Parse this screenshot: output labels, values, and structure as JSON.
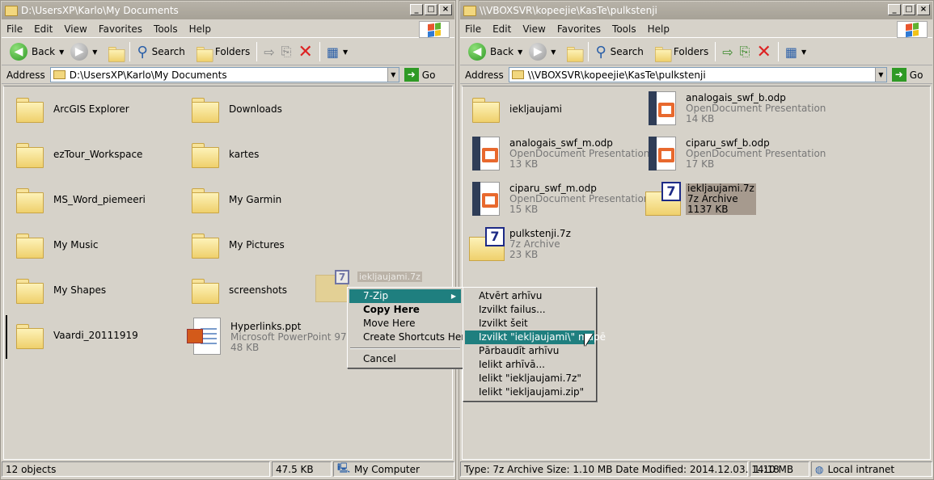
{
  "left": {
    "title": "D:\\UsersXP\\Karlo\\My Documents",
    "menu": [
      "File",
      "Edit",
      "View",
      "Favorites",
      "Tools",
      "Help"
    ],
    "toolbar": {
      "back": "Back",
      "search": "Search",
      "folders": "Folders"
    },
    "address_label": "Address",
    "address": "D:\\UsersXP\\Karlo\\My Documents",
    "go": "Go",
    "items": [
      {
        "name": "ArcGIS Explorer",
        "type": "folder"
      },
      {
        "name": "Downloads",
        "type": "folder"
      },
      {
        "name": "ezTour_Workspace",
        "type": "folder"
      },
      {
        "name": "kartes",
        "type": "folder"
      },
      {
        "name": "MS_Word_piemeeri",
        "type": "folder"
      },
      {
        "name": "My Garmin",
        "type": "folder"
      },
      {
        "name": "My Music",
        "type": "folder"
      },
      {
        "name": "My Pictures",
        "type": "folder"
      },
      {
        "name": "My Shapes",
        "type": "folder"
      },
      {
        "name": "screenshots",
        "type": "folder"
      },
      {
        "name": "Vaardi_20111919",
        "type": "folder"
      },
      {
        "name": "Hyperlinks.ppt",
        "type": "ppt",
        "desc": "Microsoft PowerPoint 97-2003",
        "size": "48 KB"
      }
    ],
    "status": {
      "count": "12 objects",
      "size": "47.5 KB",
      "location": "My Computer"
    }
  },
  "right": {
    "title": "\\\\VBOXSVR\\kopeejie\\KasTe\\pulkstenji",
    "menu": [
      "File",
      "Edit",
      "View",
      "Favorites",
      "Tools",
      "Help"
    ],
    "toolbar": {
      "back": "Back",
      "search": "Search",
      "folders": "Folders"
    },
    "address_label": "Address",
    "address": "\\\\VBOXSVR\\kopeejie\\KasTe\\pulkstenji",
    "go": "Go",
    "items": [
      {
        "name": "iekljaujami",
        "type": "folder"
      },
      {
        "name": "analogais_swf_b.odp",
        "type": "odp",
        "desc": "OpenDocument Presentation",
        "size": "14 KB"
      },
      {
        "name": "analogais_swf_m.odp",
        "type": "odp",
        "desc": "OpenDocument Presentation",
        "size": "13 KB"
      },
      {
        "name": "ciparu_swf_b.odp",
        "type": "odp",
        "desc": "OpenDocument Presentation",
        "size": "17 KB"
      },
      {
        "name": "ciparu_swf_m.odp",
        "type": "odp",
        "desc": "OpenDocument Presentation",
        "size": "15 KB"
      },
      {
        "name": "iekljaujami.7z",
        "type": "7z",
        "desc": "7z Archive",
        "size": "1137 KB"
      },
      {
        "name": "pulkstenji.7z",
        "type": "7z",
        "desc": "7z Archive",
        "size": "23 KB"
      }
    ],
    "status": {
      "info": "Type: 7z Archive Size: 1.10 MB Date Modified: 2014.12.03. 14:18",
      "size": "1.10 MB",
      "location": "Local intranet"
    }
  },
  "ghost_label": "iekljaujami.7z",
  "context_menu": [
    "7-Zip",
    "Copy Here",
    "Move Here",
    "Create Shortcuts Here",
    "Cancel"
  ],
  "submenu": [
    "Atvērt arhīvu",
    "Izvilkt failus...",
    "Izvilkt šeit",
    "Izvilkt \"iekljaujami\\\" mapē",
    "Pārbaudīt arhīvu",
    "Ielikt arhīvā...",
    "Ielikt \"iekljaujami.7z\"",
    "Ielikt \"iekljaujami.zip\""
  ],
  "colors": {
    "highlight": "#1f7f7f",
    "selection": "#a69a8e",
    "window": "#d6d2c9"
  }
}
